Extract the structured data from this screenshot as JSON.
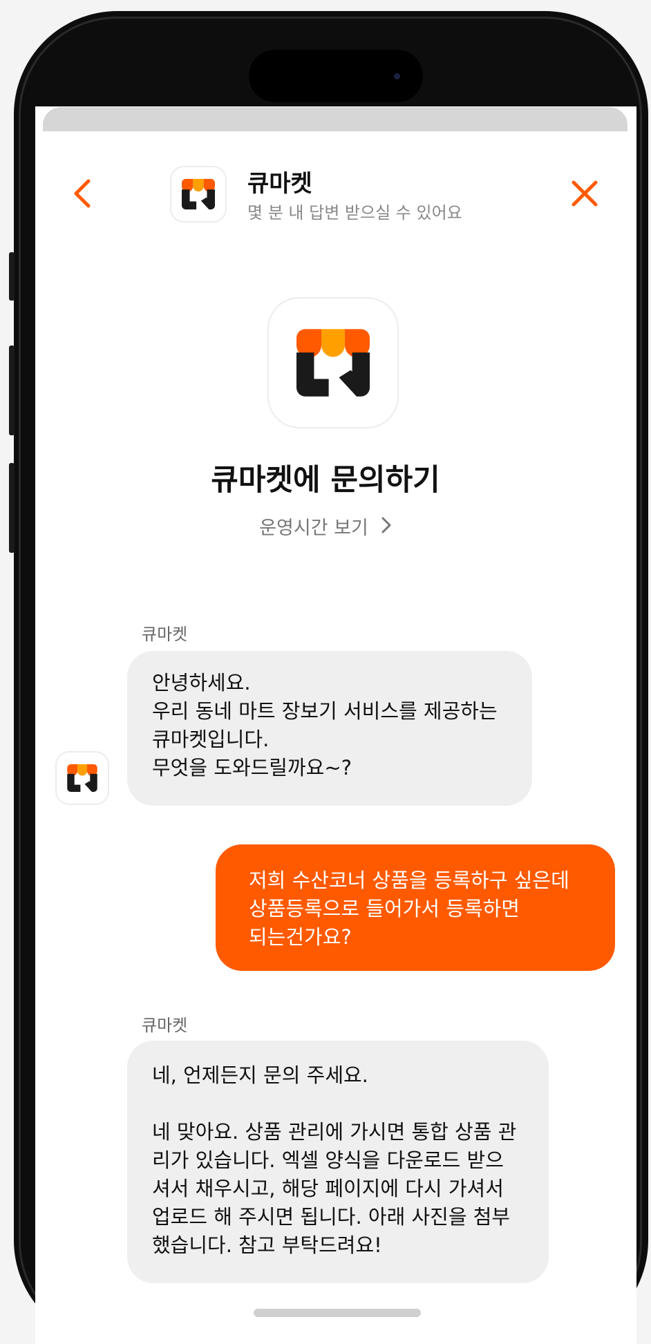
{
  "colors": {
    "brand_orange": "#ff5a00",
    "awning_yellow": "#ffa000",
    "incoming_bubble": "#efefef",
    "ink": "#111111"
  },
  "header": {
    "title": "큐마켓",
    "subtitle": "몇 분 내 답변 받으실 수 있어요",
    "back_icon": "chevron-left-icon",
    "close_icon": "close-icon"
  },
  "intro": {
    "title": "큐마켓에 문의하기",
    "hours_link": "운영시간 보기",
    "hours_icon": "chevron-right-icon"
  },
  "messages": [
    {
      "from": "incoming",
      "sender": "큐마켓",
      "lines": [
        "안녕하세요.",
        "우리 동네 마트 장보기 서비스를 제공하는",
        "큐마켓입니다.",
        "무엇을 도와드릴까요~?"
      ]
    },
    {
      "from": "outgoing",
      "lines": [
        "저희 수산코너 상품을 등록하구 싶은데",
        "상품등록으로 들어가서 등록하면",
        "되는건가요?"
      ]
    },
    {
      "from": "incoming",
      "sender": "큐마켓",
      "lines": [
        "네, 언제든지 문의 주세요.",
        "",
        "네 맞아요. 상품 관리에 가시면 통합 상품 관",
        "리가 있습니다. 엑셀 양식을 다운로드 받으",
        "셔서 채우시고, 해당 페이지에 다시 가셔서",
        "업로드 해 주시면 됩니다. 아래 사진을 첨부",
        "했습니다. 참고 부탁드려요!"
      ]
    }
  ]
}
